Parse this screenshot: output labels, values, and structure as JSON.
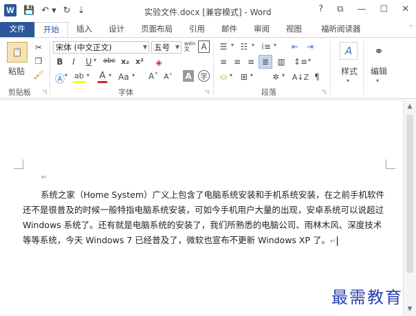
{
  "window": {
    "title": "实验文件.docx [兼容模式] - Word",
    "app_icon": "W",
    "controls": [
      "?",
      "⧉",
      "—",
      "☐",
      "✕"
    ]
  },
  "tabs": {
    "file": "文件",
    "home": "开始",
    "insert": "插入",
    "design": "设计",
    "layout": "页面布局",
    "references": "引用",
    "mailings": "邮件",
    "review": "审阅",
    "view": "视图",
    "reader": "福昕阅读器"
  },
  "ribbon": {
    "clipboard": {
      "paste": "粘贴",
      "label": "剪贴板"
    },
    "font": {
      "font_name": "宋体 (中文正文)",
      "font_size": "五号",
      "wen": "wén\n文",
      "a_box": "A",
      "bold": "B",
      "italic": "I",
      "underline": "U",
      "strike": "abc",
      "sub": "x₂",
      "sup": "x²",
      "aa_case": "Aa",
      "grow": "A˄",
      "shrink": "A˅",
      "label": "字体"
    },
    "paragraph": {
      "label": "段落"
    },
    "styles": {
      "label": "样式"
    },
    "editing": {
      "label": "编辑"
    }
  },
  "document": {
    "paragraph_mark": "↵",
    "text": "系统之家（Home System）广义上包含了电脑系统安装和手机系统安装，在之前手机软件还不是很普及的时候一般特指电脑系统安装，可如今手机用户大量的出现，安卓系统可以说超过 Windows 系统了。还有就是电脑系统的安装了，我们所熟悉的电脑公司、雨林木风、深度技术等等系统，今天 Windows 7 已经普及了，微软也宣布不更新 Windows XP 了。",
    "end_mark": "↵"
  },
  "watermark": "最需教育"
}
